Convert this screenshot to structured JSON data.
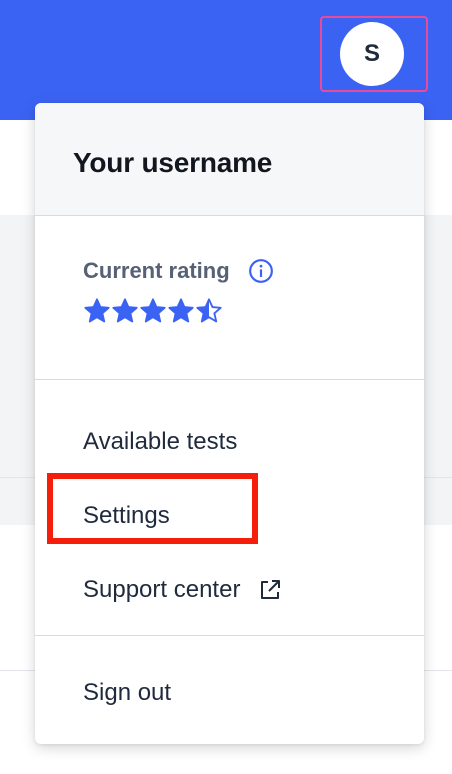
{
  "header": {
    "avatar_initial": "S"
  },
  "menu": {
    "username": "Your username",
    "rating": {
      "label": "Current rating",
      "value": 4.5,
      "max": 5
    },
    "links": [
      {
        "label": "Available tests"
      },
      {
        "label": "Settings"
      },
      {
        "label": "Support center",
        "icon": "external-link-icon"
      }
    ],
    "sign_out": "Sign out"
  },
  "colors": {
    "brand": "#3b63f3",
    "avatar_border": "#e94b9b",
    "highlight": "#f51e0a",
    "star": "#3b63f3"
  }
}
